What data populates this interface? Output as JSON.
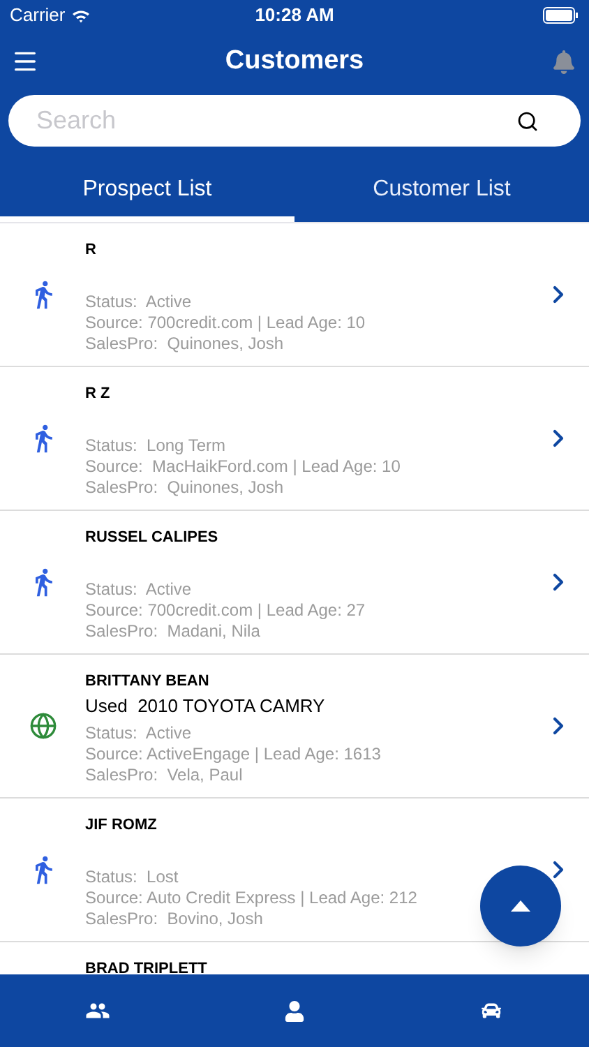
{
  "status_bar": {
    "carrier": "Carrier",
    "time": "10:28 AM"
  },
  "header": {
    "title": "Customers"
  },
  "search": {
    "placeholder": "Search"
  },
  "tabs": [
    {
      "label": "Prospect List",
      "selected": true
    },
    {
      "label": "Customer List",
      "selected": false
    }
  ],
  "customers": [
    {
      "kind": "walk-in",
      "name": "R",
      "status": "Status:  Active",
      "source": "Source: 700credit.com | Lead Age: 10",
      "sales_pro": "SalesPro:  Quinones, Josh"
    },
    {
      "kind": "walk-in",
      "name": "R Z",
      "status": "Status:  Long Term",
      "source": "Source:  MacHaikFord.com | Lead Age: 10",
      "sales_pro": "SalesPro:  Quinones, Josh"
    },
    {
      "kind": "walk-in",
      "name": "RUSSEL CALIPES",
      "status": "Status:  Active",
      "source": "Source: 700credit.com | Lead Age: 27",
      "sales_pro": "SalesPro:  Madani, Nila"
    },
    {
      "kind": "internet",
      "name": "BRITTANY BEAN",
      "vehicle": "Used  2010 TOYOTA CAMRY",
      "status": "Status:  Active",
      "source": "Source: ActiveEngage | Lead Age: 1613",
      "sales_pro": "SalesPro:  Vela, Paul"
    },
    {
      "kind": "walk-in",
      "name": "JIF ROMZ",
      "status": "Status:  Lost",
      "source": "Source: Auto Credit Express | Lead Age: 212",
      "sales_pro": "SalesPro:  Bovino, Josh"
    },
    {
      "kind": "partial",
      "name": "BRAD TRIPLETT"
    }
  ]
}
